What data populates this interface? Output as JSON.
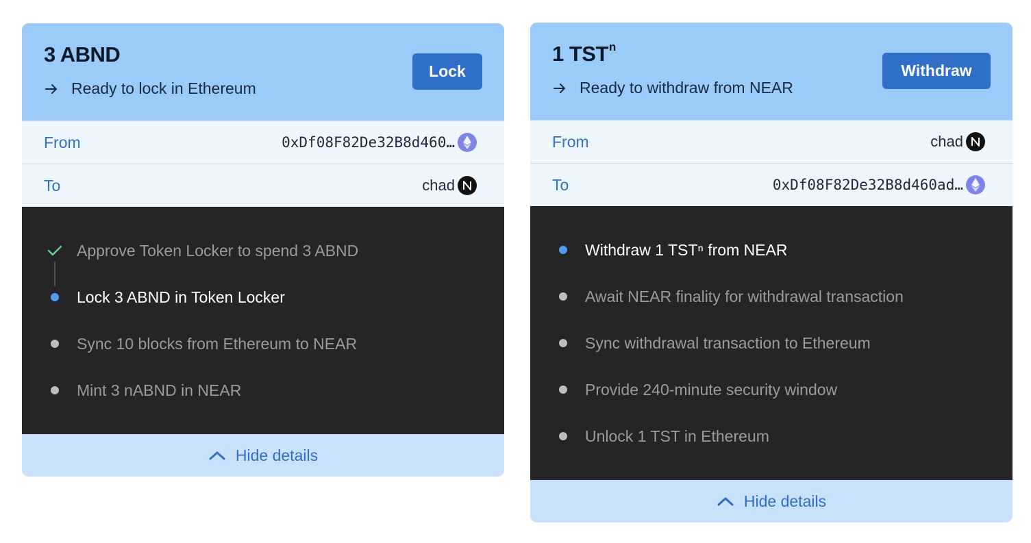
{
  "cards": [
    {
      "title": "3 ABND",
      "status": "Ready to lock in Ethereum",
      "action_label": "Lock",
      "from_label": "From",
      "from_value": "0xDf08F82De32B8d460…",
      "from_chain_icon": "ethereum-icon",
      "to_label": "To",
      "to_value": "chad",
      "to_chain_icon": "near-icon",
      "steps": [
        {
          "text": "Approve Token Locker to spend 3 ABND",
          "state": "done"
        },
        {
          "text": "Lock 3 ABND in Token Locker",
          "state": "active"
        },
        {
          "text": "Sync 10 blocks from Ethereum to NEAR",
          "state": "pending"
        },
        {
          "text": "Mint 3 nABND in NEAR",
          "state": "pending"
        }
      ],
      "hide_label": "Hide details"
    },
    {
      "title": "1 TST",
      "title_sup": "n",
      "status": "Ready to withdraw from NEAR",
      "action_label": "Withdraw",
      "from_label": "From",
      "from_value": "chad",
      "from_chain_icon": "near-icon",
      "to_label": "To",
      "to_value": "0xDf08F82De32B8d460ad…",
      "to_chain_icon": "ethereum-icon",
      "steps": [
        {
          "text": "Withdraw 1 TSTⁿ from NEAR",
          "state": "active"
        },
        {
          "text": "Await NEAR finality for withdrawal transaction",
          "state": "pending"
        },
        {
          "text": "Sync withdrawal transaction to Ethereum",
          "state": "pending"
        },
        {
          "text": "Provide 240-minute security window",
          "state": "pending"
        },
        {
          "text": "Unlock 1 TST in Ethereum",
          "state": "pending"
        }
      ],
      "hide_label": "Hide details"
    }
  ],
  "colors": {
    "header_bg": "#9bcbf8",
    "accent": "#2f6fc9",
    "row_bg": "#eef6fe",
    "steps_bg": "#252527",
    "active_dot": "#4f9cf1",
    "done_check": "#5fcf8f"
  }
}
